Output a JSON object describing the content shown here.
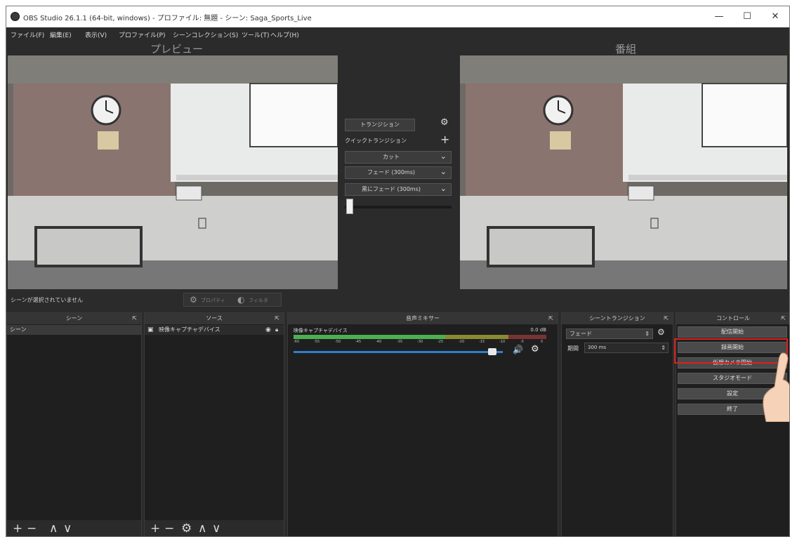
{
  "window": {
    "title": "OBS Studio 26.1.1 (64-bit, windows) - プロファイル: 無題 - シーン: Saga_Sports_Live",
    "minimize_glyph": "—",
    "maximize_glyph": "☐",
    "close_glyph": "✕"
  },
  "menu": [
    "ファイル(F)",
    "編集(E)",
    "表示(V)",
    "プロファイル(P)",
    "シーンコレクション(S)",
    "ツール(T)",
    "ヘルプ(H)"
  ],
  "preview": {
    "heading": "プレビュー"
  },
  "program": {
    "heading": "番組"
  },
  "transitions_panel": {
    "transition_button": "トランジション",
    "quick_transitions_label": "クイックトランジション",
    "add_glyph": "+",
    "gear_glyph": "⚙",
    "dropdowns": [
      "カット",
      "フェード (300ms)",
      "黒にフェード (300ms)"
    ],
    "slider_value": 0
  },
  "status": {
    "no_scene_selected": "シーンが選択されていません",
    "properties_button": "プロパティ",
    "filters_button": "フィルタ"
  },
  "scenes_dock": {
    "title": "シーン",
    "items": [
      "シーン"
    ],
    "footer": [
      "+",
      "−",
      "∧",
      "∨"
    ]
  },
  "sources_dock": {
    "title": "ソース",
    "items": [
      {
        "label": "映像キャプチャデバイス"
      }
    ],
    "footer": [
      "+",
      "−",
      "⚙",
      "∧",
      "∨"
    ]
  },
  "mixer_dock": {
    "title": "音声ミキサー",
    "channel_name": "映像キャプチャデバイス",
    "level_text": "0.0 dB",
    "scale": [
      "-60",
      "-55",
      "-50",
      "-45",
      "-40",
      "-35",
      "-30",
      "-25",
      "-20",
      "-15",
      "-10",
      "-5",
      "0"
    ],
    "volume_fraction": 0.95,
    "speaker_glyph": "🔊",
    "gear_glyph": "⚙"
  },
  "scene_transitions_dock": {
    "title": "シーントランジション",
    "selected": "フェード",
    "duration_label": "期間",
    "duration_value": "300 ms"
  },
  "controls_dock": {
    "title": "コントロール",
    "buttons": [
      "配信開始",
      "録画開始",
      "仮想カメラ開始",
      "スタジオモード",
      "設定",
      "終了"
    ],
    "highlighted": "録画開始",
    "highlight_color": "#e0201c"
  },
  "colors": {
    "background": "#2b2b2b",
    "panel": "#1f1f1f",
    "meter_green": "#4caf50",
    "meter_yellow": "#d4c23a",
    "meter_red": "#d04040",
    "slider_blue": "#2f7fd0"
  }
}
